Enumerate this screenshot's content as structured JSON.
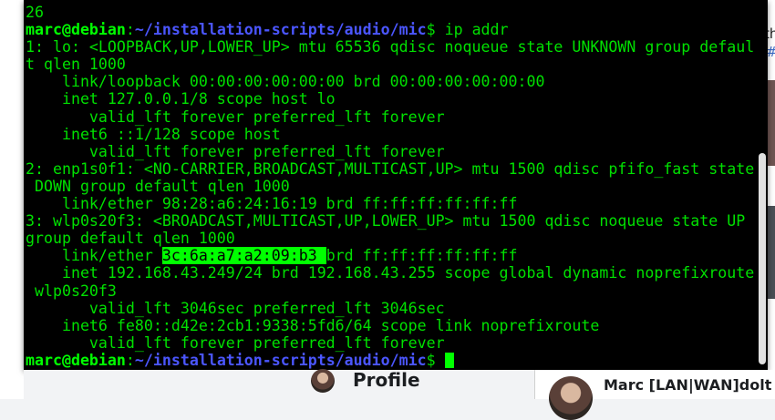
{
  "terminal": {
    "lines": [
      {
        "type": "out",
        "text": "26"
      },
      {
        "type": "prompt",
        "user": "marc@debian",
        "sep": ":",
        "path": "~/installation-scripts/audio/mic",
        "sym": "$ ",
        "cmd": "ip addr"
      },
      {
        "type": "out",
        "text": "1: lo: <LOOPBACK,UP,LOWER_UP> mtu 65536 qdisc noqueue state UNKNOWN group defaul"
      },
      {
        "type": "out",
        "text": "t qlen 1000"
      },
      {
        "type": "out",
        "text": "    link/loopback 00:00:00:00:00:00 brd 00:00:00:00:00:00"
      },
      {
        "type": "out",
        "text": "    inet 127.0.0.1/8 scope host lo"
      },
      {
        "type": "out",
        "text": "       valid_lft forever preferred_lft forever"
      },
      {
        "type": "out",
        "text": "    inet6 ::1/128 scope host"
      },
      {
        "type": "out",
        "text": "       valid_lft forever preferred_lft forever"
      },
      {
        "type": "out",
        "text": "2: enp1s0f1: <NO-CARRIER,BROADCAST,MULTICAST,UP> mtu 1500 qdisc pfifo_fast state"
      },
      {
        "type": "out",
        "text": " DOWN group default qlen 1000"
      },
      {
        "type": "out",
        "text": "    link/ether 98:28:a6:24:16:19 brd ff:ff:ff:ff:ff:ff"
      },
      {
        "type": "out",
        "text": "3: wlp0s20f3: <BROADCAST,MULTICAST,UP,LOWER_UP> mtu 1500 qdisc noqueue state UP"
      },
      {
        "type": "out",
        "text": "group default qlen 1000"
      },
      {
        "type": "sel",
        "pre": "    link/ether ",
        "sel": "3c:6a:a7:a2:09:b3 ",
        "post": "brd ff:ff:ff:ff:ff:ff"
      },
      {
        "type": "out",
        "text": "    inet 192.168.43.249/24 brd 192.168.43.255 scope global dynamic noprefixroute"
      },
      {
        "type": "out",
        "text": " wlp0s20f3"
      },
      {
        "type": "out",
        "text": "       valid_lft 3046sec preferred_lft 3046sec"
      },
      {
        "type": "out",
        "text": "    inet6 fe80::d42e:2cb1:9338:5fd6/64 scope link noprefixroute"
      },
      {
        "type": "out",
        "text": "       valid_lft forever preferred_lft forever"
      },
      {
        "type": "prompt",
        "user": "marc@debian",
        "sep": ":",
        "path": "~/installation-scripts/audio/mic",
        "sym": "$ ",
        "cmd": "",
        "cursor": true
      }
    ]
  },
  "background": {
    "right_text": "th",
    "right_hash": "#",
    "profile_label": "Profile",
    "post_author": "Marc [LAN|WAN]dolt ju"
  },
  "colors": {
    "terminal_bg": "#000000",
    "terminal_fg": "#00e000",
    "prompt_user": "#00ff00",
    "prompt_path": "#4b56ff",
    "selection_bg": "#00ff00"
  }
}
